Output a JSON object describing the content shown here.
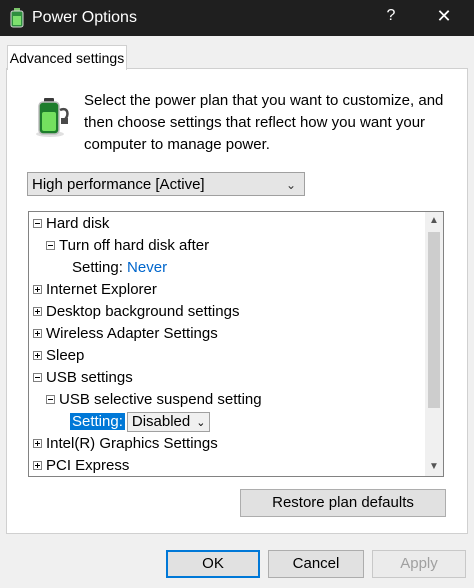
{
  "window": {
    "title": "Power Options",
    "help_label": "?",
    "close_label": "✕"
  },
  "tab": {
    "label": "Advanced settings"
  },
  "description": "Select the power plan that you want to customize, and then choose settings that reflect how you want your computer to manage power.",
  "plan_select": {
    "value": "High performance [Active]"
  },
  "tree": {
    "items": [
      {
        "label": "Hard disk",
        "expanded": true
      },
      {
        "label": "Turn off hard disk after",
        "expanded": true
      },
      {
        "label": "Setting:",
        "value": "Never"
      },
      {
        "label": "Internet Explorer",
        "expanded": false
      },
      {
        "label": "Desktop background settings",
        "expanded": false
      },
      {
        "label": "Wireless Adapter Settings",
        "expanded": false
      },
      {
        "label": "Sleep",
        "expanded": false
      },
      {
        "label": "USB settings",
        "expanded": true
      },
      {
        "label": "USB selective suspend setting",
        "expanded": true
      },
      {
        "label": "Setting:",
        "value": "Disabled"
      },
      {
        "label": "Intel(R) Graphics Settings",
        "expanded": false
      },
      {
        "label": "PCI Express",
        "expanded": false
      }
    ]
  },
  "buttons": {
    "restore": "Restore plan defaults",
    "ok": "OK",
    "cancel": "Cancel",
    "apply": "Apply"
  },
  "icons": {
    "app": "battery-icon",
    "chevron": "chevron-down-icon"
  },
  "colors": {
    "titlebar": "#1f1f1f",
    "accent": "#0078d7",
    "link": "#0066cc"
  }
}
